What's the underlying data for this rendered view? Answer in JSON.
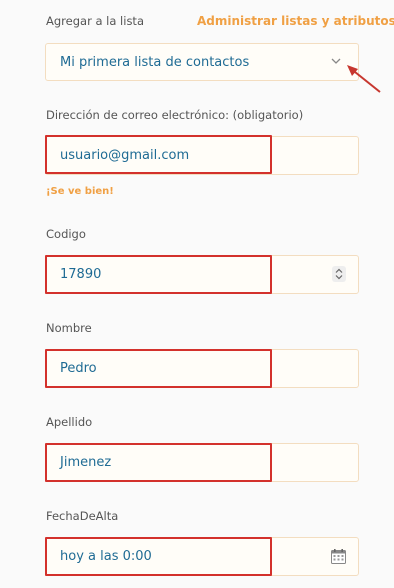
{
  "list_section": {
    "label": "Agregar a la lista",
    "manage_link": "Administrar listas y atributos",
    "selected_list": "Mi primera lista de contactos"
  },
  "fields": {
    "email": {
      "label": "Dirección de correo electrónico: (obligatorio)",
      "value": "usuario@gmail.com",
      "helper": "¡Se ve bien!"
    },
    "codigo": {
      "label": "Codigo",
      "value": "17890"
    },
    "nombre": {
      "label": "Nombre",
      "value": "Pedro"
    },
    "apellido": {
      "label": "Apellido",
      "value": "Jimenez"
    },
    "fecha_de_alta": {
      "label": "FechaDeAlta",
      "value": "hoy a las 0:00"
    }
  },
  "icons": {
    "dropdown": "chevron-down-icon",
    "stepper": "stepper-icon",
    "date_picker": "calendar-icon",
    "annotation": "annotation-arrow"
  },
  "colors": {
    "accent": "#f0a044",
    "value_text": "#1f6b94",
    "highlight_border": "#d3312c",
    "field_border": "#f3ddc0"
  }
}
